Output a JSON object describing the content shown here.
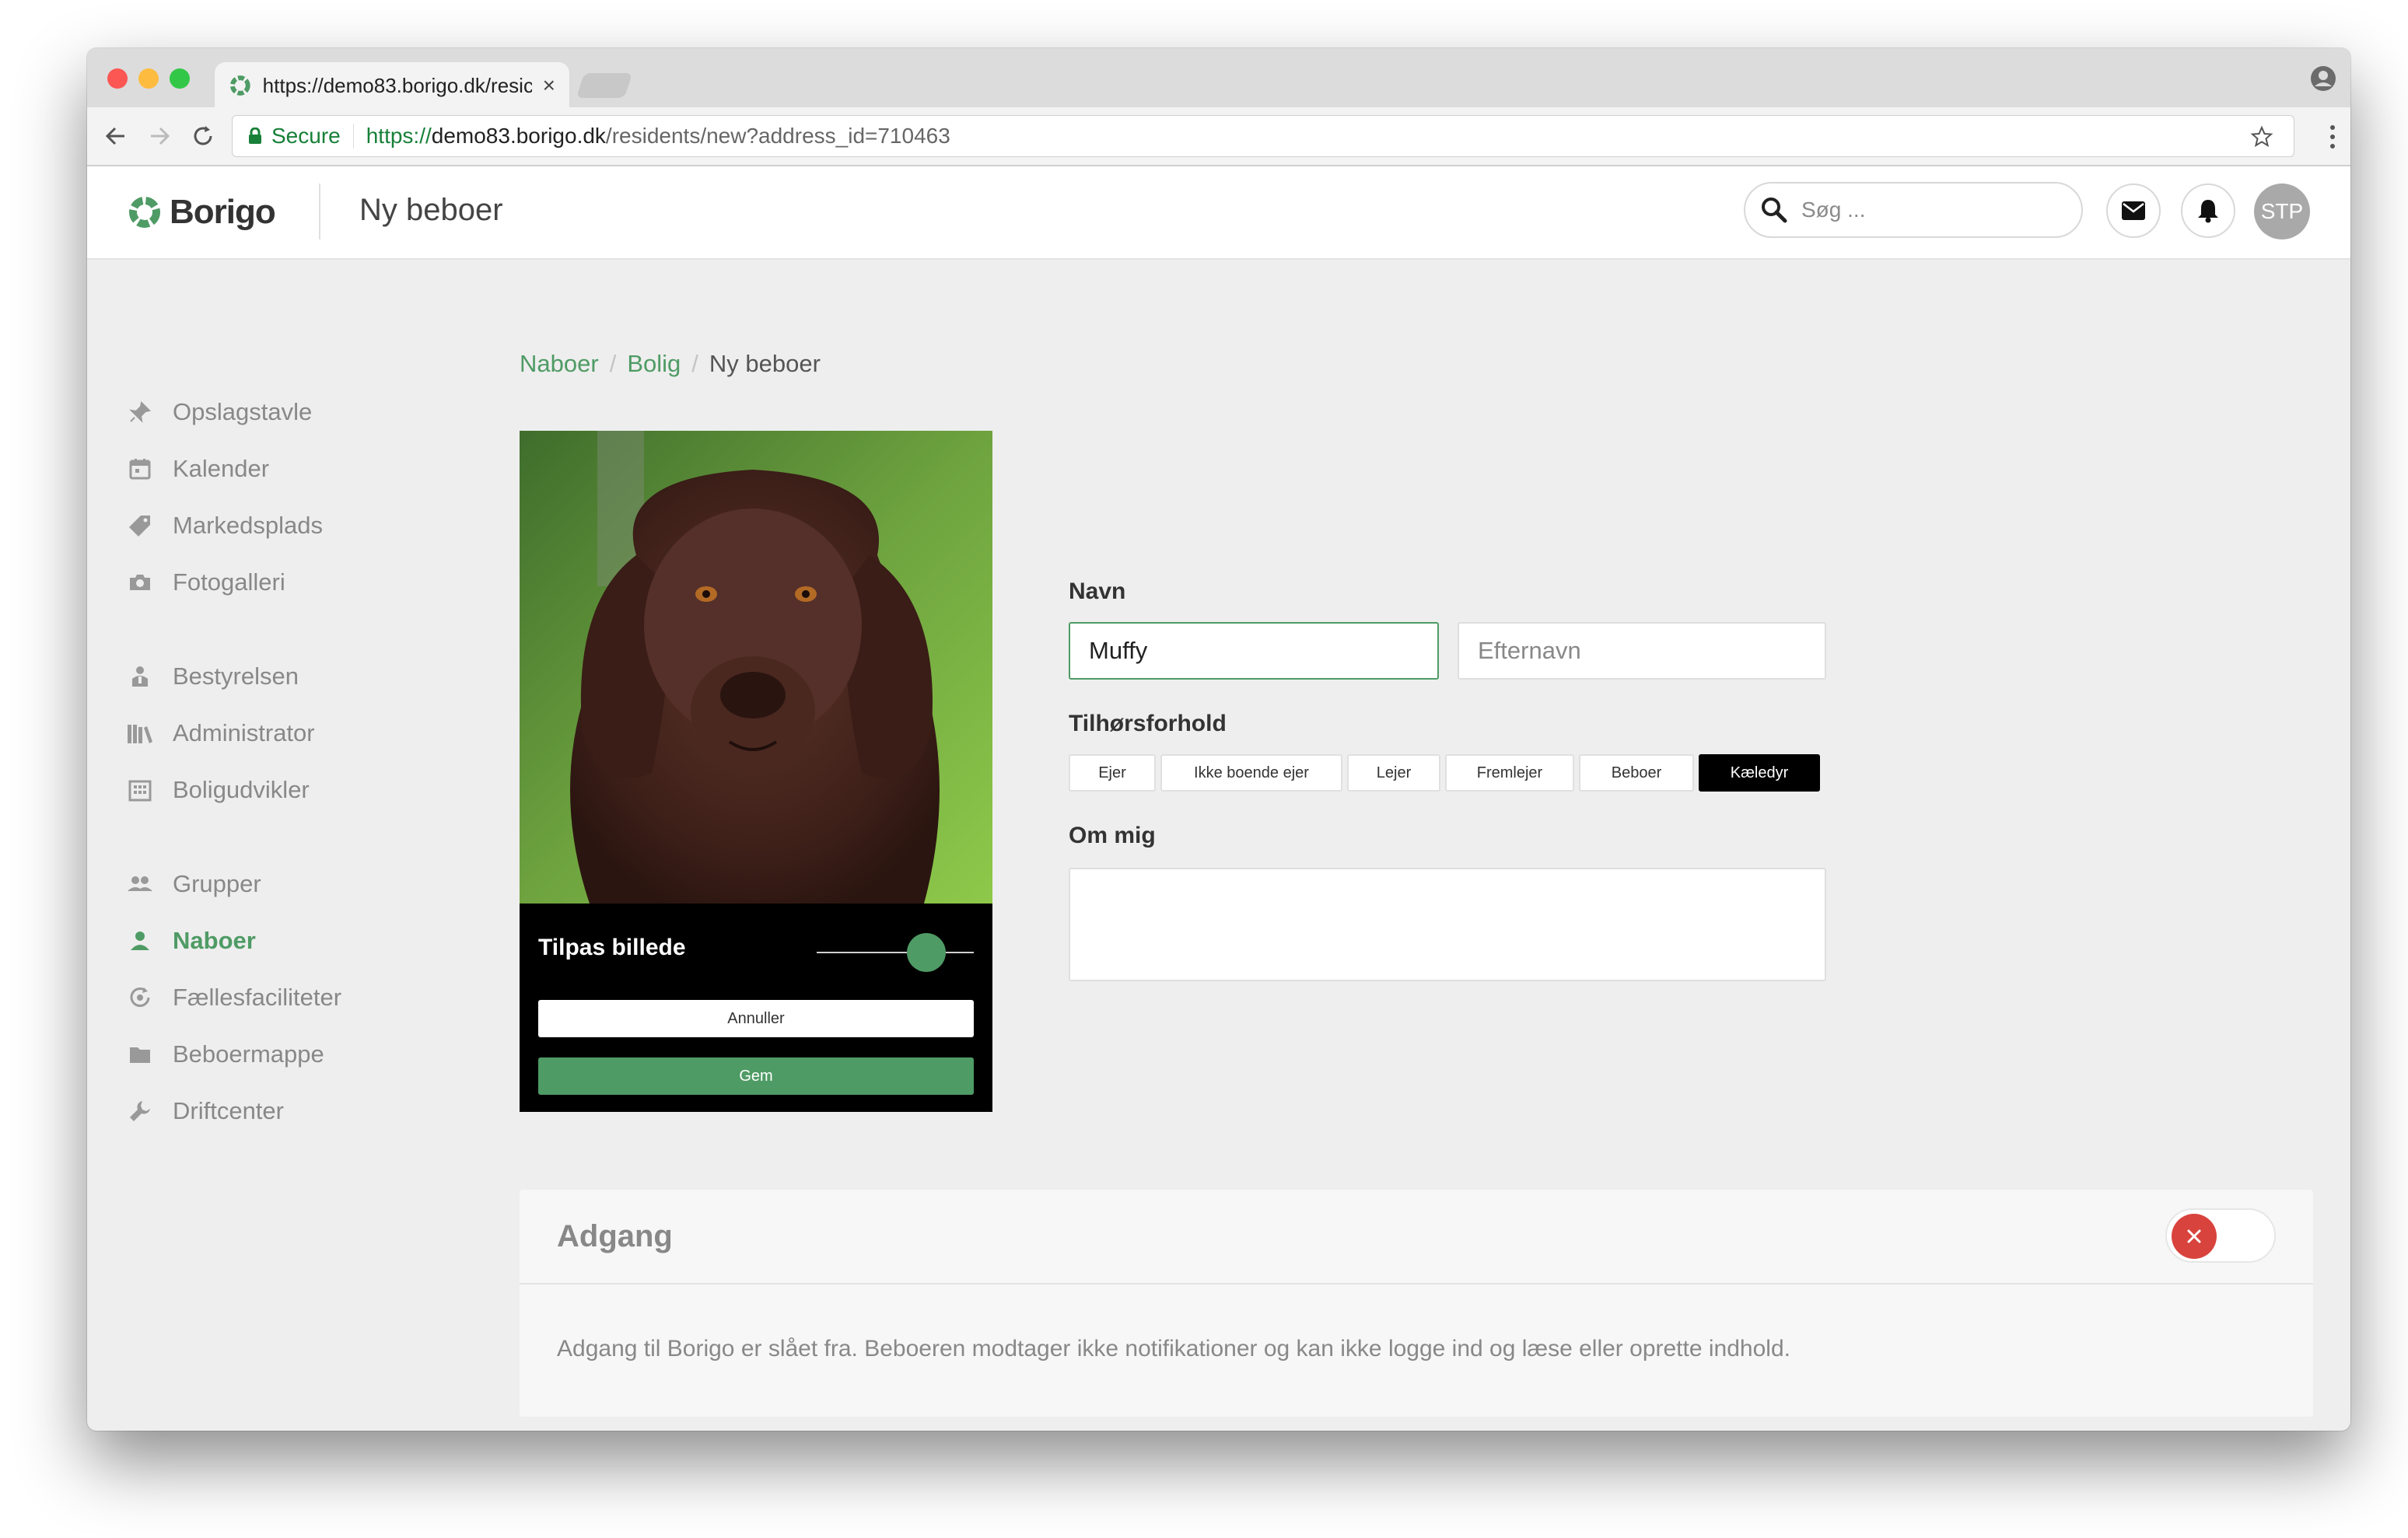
{
  "browser": {
    "tab_title": "https://demo83.borigo.dk/resic",
    "tab_close": "×",
    "secure_label": "Secure",
    "url_scheme": "https://",
    "url_host": "demo83.borigo.dk",
    "url_path": "/residents/new?address_id=710463"
  },
  "header": {
    "logo_text": "Borigo",
    "page_title": "Ny beboer",
    "search_placeholder": "Søg ...",
    "avatar_initials": "STP"
  },
  "sidebar": {
    "items": [
      {
        "label": "Opslagstavle",
        "icon": "pin-icon"
      },
      {
        "label": "Kalender",
        "icon": "calendar-icon"
      },
      {
        "label": "Markedsplads",
        "icon": "tag-icon"
      },
      {
        "label": "Fotogalleri",
        "icon": "camera-icon"
      },
      {
        "label": "Bestyrelsen",
        "icon": "board-icon"
      },
      {
        "label": "Administrator",
        "icon": "books-icon"
      },
      {
        "label": "Boligudvikler",
        "icon": "building-icon"
      },
      {
        "label": "Grupper",
        "icon": "group-icon"
      },
      {
        "label": "Naboer",
        "icon": "person-icon",
        "active": true
      },
      {
        "label": "Fællesfaciliteter",
        "icon": "facilities-icon"
      },
      {
        "label": "Beboermappe",
        "icon": "folder-icon"
      },
      {
        "label": "Driftcenter",
        "icon": "wrench-icon"
      }
    ]
  },
  "breadcrumb": {
    "items": [
      "Naboer",
      "Bolig"
    ],
    "separator": "/",
    "current": "Ny beboer"
  },
  "photo_editor": {
    "title": "Tilpas billede",
    "zoom_level": 0.7,
    "cancel_label": "Annuller",
    "save_label": "Gem"
  },
  "form": {
    "name_label": "Navn",
    "first_name_value": "Muffy",
    "last_name_placeholder": "Efternavn",
    "relation_label": "Tilhørsforhold",
    "relation_options": [
      "Ejer",
      "Ikke boende ejer",
      "Lejer",
      "Fremlejer",
      "Beboer",
      "Kæledyr"
    ],
    "relation_selected": "Kæledyr",
    "about_label": "Om mig",
    "about_value": ""
  },
  "access": {
    "title": "Adgang",
    "enabled": false,
    "description": "Adgang til Borigo er slået fra. Beboeren modtager ikke notifikationer og kan ikke logge ind og læse eller oprette indhold."
  },
  "colors": {
    "accent": "#4f9b65",
    "toggle_off": "#d9433d",
    "selected_segment": "#000000"
  }
}
